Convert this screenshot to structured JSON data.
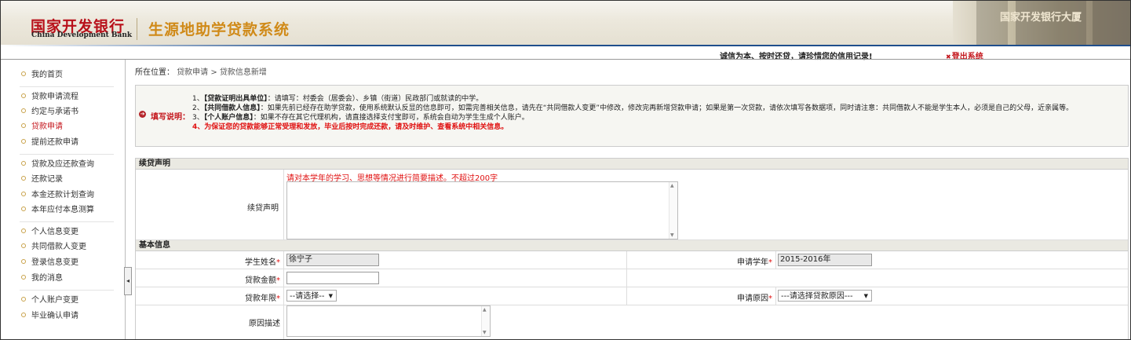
{
  "header": {
    "logo_cn": "国家开发银行",
    "logo_en": "China Development Bank",
    "system_title": "生源地助学贷款系统",
    "photo_text": "国家开发银行大厦",
    "slogan": "诚信为本、按时还贷，请珍惜您的信用记录!",
    "logout_label": "登出系统"
  },
  "sidebar": {
    "items": [
      {
        "label": "我的首页"
      },
      {
        "label": "贷款申请流程"
      },
      {
        "label": "约定与承诺书"
      },
      {
        "label": "贷款申请"
      },
      {
        "label": "提前还款申请"
      },
      {
        "label": "贷款及应还款查询"
      },
      {
        "label": "还款记录"
      },
      {
        "label": "本金还款计划查询"
      },
      {
        "label": "本年应付本息测算"
      },
      {
        "label": "个人信息变更"
      },
      {
        "label": "共同借款人变更"
      },
      {
        "label": "登录信息变更"
      },
      {
        "label": "我的消息"
      },
      {
        "label": "个人账户变更"
      },
      {
        "label": "毕业确认申请"
      }
    ],
    "active_index": 3
  },
  "breadcrumb": {
    "label": "所在位置：",
    "path": "贷款申请 > 贷款信息新增"
  },
  "note": {
    "label": "填写说明：",
    "lines": [
      {
        "num": "1、",
        "bold": "【贷款证明出具单位】",
        "text": "：请填写：村委会（居委会）、乡镇（街道）民政部门或就读的中学。"
      },
      {
        "num": "2、",
        "bold": "【共同借款人信息】",
        "text": "：如果先前已经存在助学贷款，使用系统默认反显的信息即可，如需完善相关信息，请先在“共同借款人变更”中修改，修改完再新增贷款申请；如果是第一次贷款，请依次填写各数据项，同时请注意：共同借款人不能是学生本人，必须是自己的父母，近亲属等。"
      },
      {
        "num": "3、",
        "bold": "【个人账户信息】",
        "text": "：如果不存在其它代理机构，请直接选择支付宝即可，系统会自动为学生生成个人账户。"
      }
    ],
    "warning": "4、为保证您的贷款能够正常受理和发放，毕业后按时完成还款，请及时维护、查看系统中相关信息。"
  },
  "form": {
    "section_continue": "续贷声明",
    "continue_hint": "请对本学年的学习、思想等情况进行简要描述。不超过200字",
    "continue_label": "续贷声明",
    "section_basic": "基本信息",
    "student_name_label": "学生姓名",
    "student_name_value": "徐宁子",
    "apply_year_label": "申请学年",
    "apply_year_value": "2015-2016年",
    "loan_amount_label": "贷款金额",
    "loan_amount_value": "",
    "loan_term_label": "贷款年限",
    "loan_term_value": "--请选择--",
    "apply_reason_label": "申请原因",
    "apply_reason_value": "---请选择贷款原因---",
    "reason_desc_label": "原因描述",
    "required_mark": "*"
  }
}
